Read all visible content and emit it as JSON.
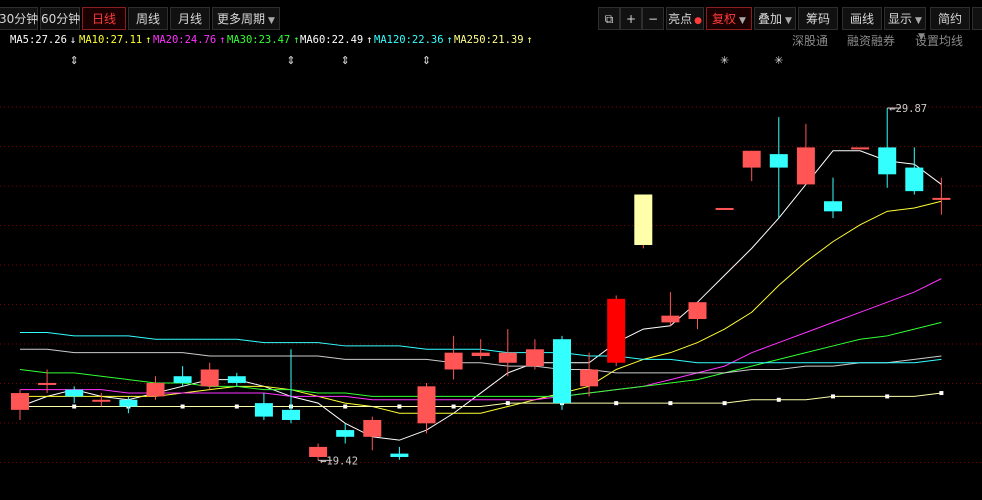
{
  "toolbar": {
    "left_buttons": [
      "30分钟",
      "60分钟",
      "日线",
      "周线",
      "月线",
      "更多周期"
    ],
    "active_period": "日线",
    "right_buttons": [
      "亮点",
      "复权",
      "叠加",
      "筹码",
      "画线",
      "显示",
      "简约"
    ],
    "restore_label": "复权"
  },
  "ma_legend": [
    {
      "label": "MA5:27.26",
      "color": "#ffffff",
      "arrow": "↓"
    },
    {
      "label": "MA10:27.11",
      "color": "#ffff33",
      "arrow": "↑"
    },
    {
      "label": "MA20:24.76",
      "color": "#ff33ff",
      "arrow": "↑"
    },
    {
      "label": "MA30:23.47",
      "color": "#33ff33",
      "arrow": "↑"
    },
    {
      "label": "MA60:22.49",
      "color": "#ffffff",
      "arrow": "↑"
    },
    {
      "label": "MA120:22.36",
      "color": "#33ffff",
      "arrow": "↑"
    },
    {
      "label": "MA250:21.39",
      "color": "#ffff88",
      "arrow": "↑"
    }
  ],
  "right_links": [
    "深股通",
    "融资融券",
    "设置均线"
  ],
  "colors": {
    "up": "#ff5555",
    "down": "#33ffff",
    "ma5": "#ffffff",
    "ma10": "#ffff33",
    "ma20": "#ff33ff",
    "ma30": "#33ff33",
    "ma60": "#cccccc",
    "ma120": "#33ffff",
    "ma250": "#ffffaa",
    "grid": "#7a0000"
  },
  "chart_data": {
    "type": "candlestick",
    "y_range": [
      18.4,
      31.0
    ],
    "max_label": "29.87",
    "min_label": "19.42",
    "candles": [
      {
        "o": 20.9,
        "c": 21.4,
        "h": 21.5,
        "l": 20.6
      },
      {
        "o": 21.7,
        "c": 21.7,
        "h": 22.1,
        "l": 21.4
      },
      {
        "o": 21.5,
        "c": 21.3,
        "h": 21.6,
        "l": 21.1
      },
      {
        "o": 21.2,
        "c": 21.2,
        "h": 21.4,
        "l": 21.0
      },
      {
        "o": 21.2,
        "c": 21.0,
        "h": 21.3,
        "l": 20.8
      },
      {
        "o": 21.3,
        "c": 21.7,
        "h": 21.9,
        "l": 21.2
      },
      {
        "o": 21.9,
        "c": 21.7,
        "h": 22.2,
        "l": 21.6
      },
      {
        "o": 21.6,
        "c": 22.1,
        "h": 22.3,
        "l": 21.5
      },
      {
        "o": 21.9,
        "c": 21.7,
        "h": 22.0,
        "l": 21.6
      },
      {
        "o": 21.1,
        "c": 20.7,
        "h": 21.4,
        "l": 20.6
      },
      {
        "o": 20.9,
        "c": 20.6,
        "h": 22.7,
        "l": 20.5
      },
      {
        "o": 19.5,
        "c": 19.8,
        "h": 19.9,
        "l": 19.4
      },
      {
        "o": 20.3,
        "c": 20.1,
        "h": 20.5,
        "l": 19.9
      },
      {
        "o": 20.1,
        "c": 20.6,
        "h": 20.7,
        "l": 19.7
      },
      {
        "o": 19.6,
        "c": 19.5,
        "h": 19.8,
        "l": 19.42
      },
      {
        "o": 20.5,
        "c": 21.6,
        "h": 21.7,
        "l": 20.2
      },
      {
        "o": 22.1,
        "c": 22.6,
        "h": 23.1,
        "l": 21.8
      },
      {
        "o": 22.5,
        "c": 22.6,
        "h": 23.0,
        "l": 22.4
      },
      {
        "o": 22.3,
        "c": 22.6,
        "h": 23.3,
        "l": 21.9
      },
      {
        "o": 22.2,
        "c": 22.7,
        "h": 23.0,
        "l": 22.1
      },
      {
        "o": 23.0,
        "c": 21.1,
        "h": 23.1,
        "l": 20.9
      },
      {
        "o": 21.6,
        "c": 22.1,
        "h": 22.6,
        "l": 21.3
      },
      {
        "o": 22.3,
        "c": 24.2,
        "h": 24.3,
        "l": 22.2
      },
      {
        "o": 25.8,
        "c": 27.3,
        "h": 27.3,
        "l": 25.7
      },
      {
        "o": 23.5,
        "c": 23.7,
        "h": 24.4,
        "l": 23.4
      },
      {
        "o": 23.6,
        "c": 24.1,
        "h": 24.1,
        "l": 23.3
      },
      {
        "o": 26.9,
        "c": 26.9,
        "h": 26.9,
        "l": 26.9
      },
      {
        "o": 28.1,
        "c": 28.6,
        "h": 28.6,
        "l": 27.7
      },
      {
        "o": 28.5,
        "c": 28.1,
        "h": 29.6,
        "l": 26.6
      },
      {
        "o": 27.6,
        "c": 28.7,
        "h": 29.4,
        "l": 27.6
      },
      {
        "o": 27.1,
        "c": 26.8,
        "h": 27.8,
        "l": 26.6
      },
      {
        "o": 28.7,
        "c": 28.7,
        "h": 28.7,
        "l": 28.7
      },
      {
        "o": 28.7,
        "c": 27.9,
        "h": 29.87,
        "l": 27.5
      },
      {
        "o": 28.1,
        "c": 27.4,
        "h": 28.7,
        "l": 27.3
      },
      {
        "o": 27.2,
        "c": 27.2,
        "h": 27.8,
        "l": 26.7
      }
    ],
    "ma_lines": {
      "ma5": [
        21.0,
        21.3,
        21.5,
        21.3,
        21.2,
        21.4,
        21.6,
        21.8,
        21.8,
        21.6,
        21.3,
        21.1,
        20.5,
        20.1,
        20.0,
        20.3,
        20.8,
        21.4,
        22.0,
        22.3,
        22.3,
        22.3,
        22.9,
        23.3,
        23.4,
        24.1,
        24.9,
        25.7,
        26.6,
        27.6,
        28.6,
        28.6,
        28.3,
        28.2,
        27.6
      ],
      "ma10": [
        21.3,
        21.3,
        21.3,
        21.3,
        21.3,
        21.3,
        21.4,
        21.5,
        21.6,
        21.6,
        21.5,
        21.3,
        21.1,
        21.0,
        20.8,
        20.8,
        20.8,
        20.8,
        21.0,
        21.2,
        21.4,
        21.6,
        22.1,
        22.4,
        22.6,
        22.9,
        23.3,
        23.8,
        24.6,
        25.3,
        25.9,
        26.4,
        26.8,
        26.9,
        27.1
      ],
      "ma20": [
        21.5,
        21.5,
        21.5,
        21.5,
        21.4,
        21.4,
        21.4,
        21.4,
        21.4,
        21.4,
        21.3,
        21.3,
        21.3,
        21.2,
        21.2,
        21.2,
        21.2,
        21.2,
        21.2,
        21.2,
        21.3,
        21.4,
        21.5,
        21.6,
        21.8,
        22.0,
        22.2,
        22.6,
        22.9,
        23.2,
        23.5,
        23.8,
        24.1,
        24.4,
        24.8
      ],
      "ma30": [
        22.1,
        22.0,
        22.0,
        21.9,
        21.8,
        21.7,
        21.7,
        21.6,
        21.6,
        21.5,
        21.5,
        21.4,
        21.4,
        21.3,
        21.3,
        21.3,
        21.3,
        21.3,
        21.3,
        21.3,
        21.3,
        21.4,
        21.5,
        21.6,
        21.7,
        21.8,
        22.0,
        22.2,
        22.4,
        22.6,
        22.8,
        23.0,
        23.1,
        23.3,
        23.5
      ],
      "ma60": [
        22.7,
        22.7,
        22.6,
        22.6,
        22.6,
        22.6,
        22.6,
        22.5,
        22.5,
        22.5,
        22.5,
        22.5,
        22.4,
        22.4,
        22.4,
        22.4,
        22.3,
        22.3,
        22.2,
        22.2,
        22.1,
        22.1,
        22.0,
        22.0,
        22.0,
        22.0,
        22.0,
        22.1,
        22.1,
        22.2,
        22.2,
        22.3,
        22.3,
        22.4,
        22.5
      ],
      "ma120": [
        23.2,
        23.2,
        23.1,
        23.1,
        23.1,
        23.0,
        23.0,
        23.0,
        23.0,
        22.9,
        22.9,
        22.9,
        22.8,
        22.8,
        22.8,
        22.7,
        22.7,
        22.7,
        22.6,
        22.6,
        22.6,
        22.5,
        22.5,
        22.4,
        22.4,
        22.3,
        22.3,
        22.3,
        22.3,
        22.3,
        22.3,
        22.3,
        22.3,
        22.3,
        22.4
      ],
      "ma250": [
        21.0,
        21.0,
        21.0,
        21.0,
        21.0,
        21.0,
        21.0,
        21.0,
        21.0,
        21.0,
        21.0,
        21.0,
        21.0,
        21.0,
        21.0,
        21.0,
        21.0,
        21.0,
        21.1,
        21.1,
        21.1,
        21.1,
        21.1,
        21.1,
        21.1,
        21.1,
        21.1,
        21.2,
        21.2,
        21.2,
        21.3,
        21.3,
        21.3,
        21.3,
        21.4
      ]
    },
    "event_markers": [
      {
        "index": 2,
        "symbol": "⇕"
      },
      {
        "index": 10,
        "symbol": "⇕"
      },
      {
        "index": 12,
        "symbol": "⇕"
      },
      {
        "index": 15,
        "symbol": "⇕"
      },
      {
        "index": 26,
        "symbol": "✳"
      },
      {
        "index": 28,
        "symbol": "✳"
      }
    ]
  }
}
